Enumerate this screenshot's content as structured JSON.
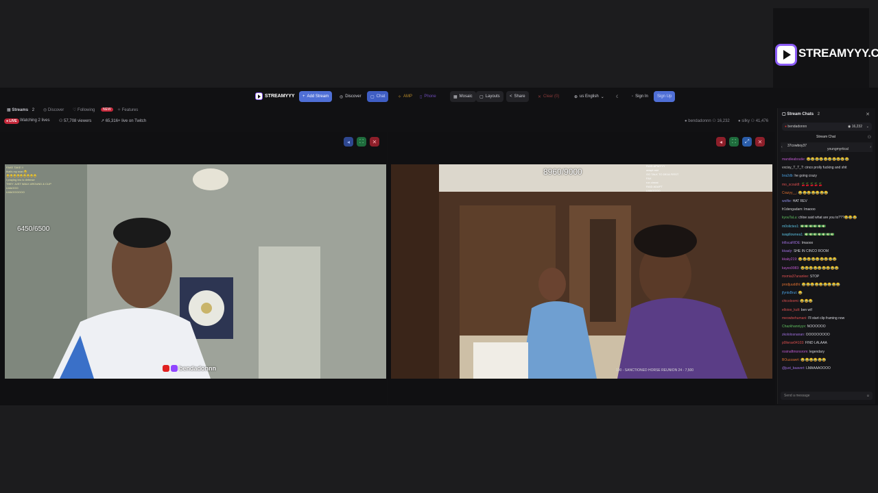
{
  "promo": {
    "title": "STREAMYYY.COM"
  },
  "nav": {
    "brand": "STREAMYYY",
    "add_stream": "Add Stream",
    "discover": "Discover",
    "chat": "Chat",
    "amp": "AMP",
    "phone": "Phone",
    "mosaic": "Mosaic",
    "layouts": "Layouts",
    "share": "Share",
    "clear": "Clear (0)",
    "language": "us English",
    "sign_in": "Sign In",
    "sign_up": "Sign Up"
  },
  "subbar": {
    "streams": "Streams",
    "streams_count": "2",
    "discover": "Discover",
    "following": "Following",
    "following_badge": "NEW",
    "features": "Features"
  },
  "statbar": {
    "live": "LIVE",
    "watching": "Watching 2 lives",
    "viewers": "57,708 viewers",
    "twitch": "65,316+ live on Twitch",
    "stream1_name": "bendadonnn",
    "stream1_viewers": "16,232",
    "stream2_name": "silky",
    "stream2_viewers": "41,476"
  },
  "streams": [
    {
      "counter": "6450/6500",
      "channel": "bendadonnn"
    },
    {
      "counter": "8960/9000",
      "ticker": "100 - SANCTIONED HORSE REUNION 24 - 7,500"
    }
  ],
  "chat": {
    "title": "Stream Chats",
    "count": "2",
    "selected_channel": "bendadonnn",
    "selected_viewers": "16,232",
    "subtitle": "Stream Chat",
    "pin_user": "37cowboy37",
    "pin_user2": "youngmyrtical",
    "input_placeholder": "Send a message",
    "messages": [
      {
        "user": "mandieaboutie:",
        "text": "😂😂😂😂😂😂😂😂😂😂",
        "color": "#c05ad0"
      },
      {
        "user": "vxcisy_T_T_T:",
        "text": "cinco prolly fucking and shit",
        "color": "#d0d0d0"
      },
      {
        "user": "bra2db:",
        "text": "he going crazy",
        "color": "#4aa0e0"
      },
      {
        "user": "mo_scouldl:",
        "text": "🍒🍒🍒🍒🍒",
        "color": "#e05050"
      },
      {
        "user": "Crazyy__:",
        "text": "😂😂😂😂😂😂😂",
        "color": "#e07030"
      },
      {
        "user": "wolfie:",
        "text": "HAT REV",
        "color": "#8a8ae0"
      },
      {
        "user": "fr1dengadam:",
        "text": "lmaooo",
        "color": "#d0d0d0"
      },
      {
        "user": "kyouTaLu:",
        "text": "chloe said what are you to???😂😂😂",
        "color": "#60c060"
      },
      {
        "user": "m0olictes1:",
        "text": "💵💵💵💵💵💵",
        "color": "#5ac0e0"
      },
      {
        "user": "iwapllownea1:",
        "text": "💵💵💵💵💵💵💵",
        "color": "#5ac0e0"
      },
      {
        "user": "trillscaRIDE:",
        "text": "lmaooo",
        "color": "#a070e0"
      },
      {
        "user": "kkaaly:",
        "text": "SHE IN CINCO ROOM",
        "color": "#a070e0"
      },
      {
        "user": "kkaky219:",
        "text": "😂😂😂😂😂😂😂😂😂",
        "color": "#c05ad0"
      },
      {
        "user": "kayes9983:",
        "text": "😂😂😂😂😂😂😂😂😂",
        "color": "#c05ad0"
      },
      {
        "user": "mxmia37ananlee:",
        "text": "STOP",
        "color": "#e05050"
      },
      {
        "user": "prodjuuddhi:",
        "text": "😂😂😂😂😂😂😂😂😂",
        "color": "#e07030"
      },
      {
        "user": "jfyntsBrut:",
        "text": "😂",
        "color": "#4aa0e0"
      },
      {
        "user": "chicoloomi:",
        "text": "😂😂😂",
        "color": "#e05050"
      },
      {
        "user": "elloioo_kult:",
        "text": "ben wtf",
        "color": "#e05050"
      },
      {
        "user": "meowbehumani:",
        "text": "I'll start clip framing now",
        "color": "#e05050"
      },
      {
        "user": "Chazkhanniyyx:",
        "text": "NOOOOOO",
        "color": "#60c060"
      },
      {
        "user": "zkololosnanan:",
        "text": "OOOOOOOOO",
        "color": "#a070e0"
      },
      {
        "user": "p0livrav04103:",
        "text": "FIND LALAAA",
        "color": "#e05050"
      },
      {
        "user": "rosinaftmonsrom:",
        "text": "legendary",
        "color": "#c05ad0"
      },
      {
        "user": "BOuzzawrt:",
        "text": "😂😂😂😂😂😂",
        "color": "#e07030"
      },
      {
        "user": "@just_baavert:",
        "text": "LMAAAAOOOO",
        "color": "#a070e0"
      }
    ]
  }
}
